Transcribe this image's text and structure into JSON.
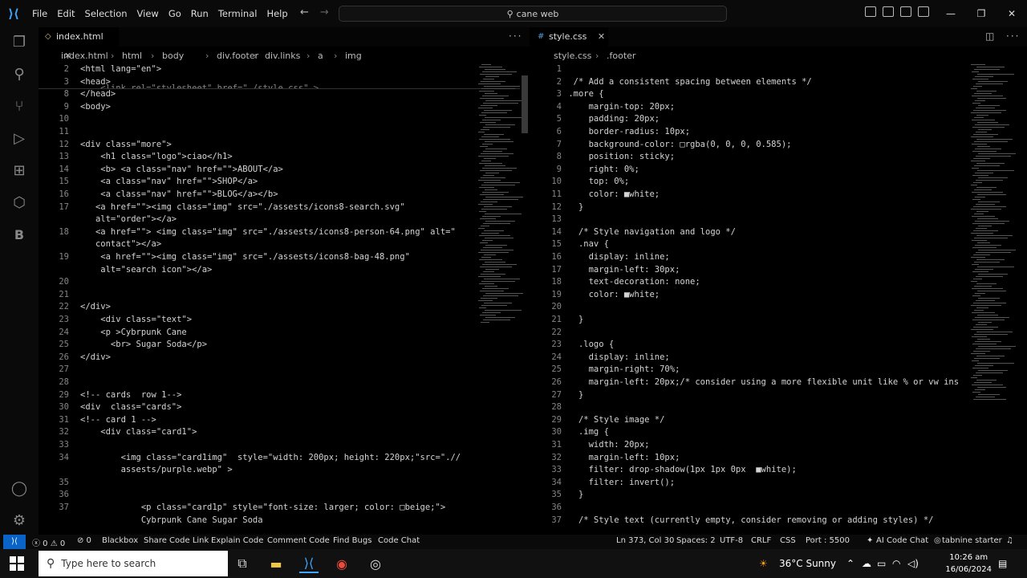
{
  "window": {
    "search_text": "cane web",
    "menu": [
      "File",
      "Edit",
      "Selection",
      "View",
      "Go",
      "Run",
      "Terminal",
      "Help"
    ]
  },
  "left_editor": {
    "tab": "index.html",
    "breadcrumb": [
      "index.html",
      "html",
      "body",
      "div.footer",
      "div.links",
      "a",
      "img"
    ],
    "lines": [
      {
        "n": "2",
        "text": "<html lang=\"en\">"
      },
      {
        "n": "3",
        "text": "<head>"
      },
      {
        "n": "8",
        "text": "</head>"
      },
      {
        "n": "9",
        "text": "<body>"
      },
      {
        "n": "10",
        "text": ""
      },
      {
        "n": "11",
        "text": ""
      },
      {
        "n": "12",
        "text": "<div class=\"more\">"
      },
      {
        "n": "13",
        "text": "    <h1 class=\"logo\">ciao</h1>"
      },
      {
        "n": "14",
        "text": "    <b> <a class=\"nav\" href=\"\">ABOUT</a>"
      },
      {
        "n": "15",
        "text": "    <a class=\"nav\" href=\"\">SHOP</a>"
      },
      {
        "n": "16",
        "text": "    <a class=\"nav\" href=\"\">BLOG</a></b>"
      },
      {
        "n": "17",
        "text": "   <a href=\"\"><img class=\"img\" src=\"./assests/icons8-search.svg\""
      },
      {
        "n": "",
        "text": "   alt=\"order\"></a>"
      },
      {
        "n": "18",
        "text": "   <a href=\"\"> <img class=\"img\" src=\"./assests/icons8-person-64.png\" alt=\""
      },
      {
        "n": "",
        "text": "   contact\"></a>"
      },
      {
        "n": "19",
        "text": "    <a href=\"\"><img class=\"img\" src=\"./assests/icons8-bag-48.png\""
      },
      {
        "n": "",
        "text": "    alt=\"search icon\"></a>"
      },
      {
        "n": "20",
        "text": ""
      },
      {
        "n": "21",
        "text": ""
      },
      {
        "n": "22",
        "text": "</div>"
      },
      {
        "n": "23",
        "text": "    <div class=\"text\">"
      },
      {
        "n": "24",
        "text": "    <p >Cybrpunk Cane"
      },
      {
        "n": "25",
        "text": "      <br> Sugar Soda</p>"
      },
      {
        "n": "26",
        "text": "</div>"
      },
      {
        "n": "27",
        "text": ""
      },
      {
        "n": "28",
        "text": ""
      },
      {
        "n": "29",
        "text": "<!-- cards  row 1-->"
      },
      {
        "n": "30",
        "text": "<div  class=\"cards\">"
      },
      {
        "n": "31",
        "text": "<!-- card 1 -->"
      },
      {
        "n": "32",
        "text": "    <div class=\"card1\">"
      },
      {
        "n": "33",
        "text": ""
      },
      {
        "n": "34",
        "text": "        <img class=\"card1img\"  style=\"width: 200px; height: 220px;\"src=\".//"
      },
      {
        "n": "",
        "text": "        assests/purple.webp\" >"
      },
      {
        "n": "35",
        "text": ""
      },
      {
        "n": "36",
        "text": ""
      },
      {
        "n": "37",
        "text": "            <p class=\"card1p\" style=\"font-size: larger; color: □beige;\">"
      },
      {
        "n": "",
        "text": "            Cybrpunk Cane Sugar Soda"
      }
    ],
    "sticky_partial": "    <link rel=\"stylesheet\" href=\"./style.css\" >"
  },
  "right_editor": {
    "tab": "style.css",
    "breadcrumb": [
      "style.css",
      ".footer"
    ],
    "lines": [
      {
        "n": "1",
        "text": ""
      },
      {
        "n": "2",
        "text": "  /* Add a consistent spacing between elements */"
      },
      {
        "n": "3",
        "text": " .more {"
      },
      {
        "n": "4",
        "text": "     margin-top: 20px;"
      },
      {
        "n": "5",
        "text": "     padding: 20px;"
      },
      {
        "n": "6",
        "text": "     border-radius: 10px;"
      },
      {
        "n": "7",
        "text": "     background-color: □rgba(0, 0, 0, 0.585);"
      },
      {
        "n": "8",
        "text": "     position: sticky;"
      },
      {
        "n": "9",
        "text": "     right: 0%;"
      },
      {
        "n": "10",
        "text": "     top: 0%;"
      },
      {
        "n": "11",
        "text": "     color: ■white;"
      },
      {
        "n": "12",
        "text": "   }"
      },
      {
        "n": "13",
        "text": ""
      },
      {
        "n": "14",
        "text": "   /* Style navigation and logo */"
      },
      {
        "n": "15",
        "text": "   .nav {"
      },
      {
        "n": "16",
        "text": "     display: inline;"
      },
      {
        "n": "17",
        "text": "     margin-left: 30px;"
      },
      {
        "n": "18",
        "text": "     text-decoration: none;"
      },
      {
        "n": "19",
        "text": "     color: ■white;"
      },
      {
        "n": "20",
        "text": ""
      },
      {
        "n": "21",
        "text": "   }"
      },
      {
        "n": "22",
        "text": ""
      },
      {
        "n": "23",
        "text": "   .logo {"
      },
      {
        "n": "24",
        "text": "     display: inline;"
      },
      {
        "n": "25",
        "text": "     margin-right: 70%;"
      },
      {
        "n": "26",
        "text": "     margin-left: 20px;/* consider using a more flexible unit like % or vw ins"
      },
      {
        "n": "27",
        "text": "   }"
      },
      {
        "n": "28",
        "text": ""
      },
      {
        "n": "29",
        "text": "   /* Style image */"
      },
      {
        "n": "30",
        "text": "   .img {"
      },
      {
        "n": "31",
        "text": "     width: 20px;"
      },
      {
        "n": "32",
        "text": "     margin-left: 10px;"
      },
      {
        "n": "33",
        "text": "     filter: drop-shadow(1px 1px 0px  ■white);"
      },
      {
        "n": "34",
        "text": "     filter: invert();"
      },
      {
        "n": "35",
        "text": "   }"
      },
      {
        "n": "36",
        "text": ""
      },
      {
        "n": "37",
        "text": "   /* Style text (currently empty, consider removing or adding styles) */"
      }
    ]
  },
  "statusbar": {
    "errors": "ⓧ 0 ⚠ 0",
    "info": "⊘ 0",
    "items_left": [
      "Blackbox",
      "Share Code Link",
      "Explain Code",
      "Comment Code",
      "Find Bugs",
      "Code Chat"
    ],
    "position": "Ln 373, Col 30",
    "spaces": "Spaces: 2",
    "encoding": "UTF-8",
    "eol": "CRLF",
    "language": "CSS",
    "port": "Port : 5500",
    "ai_chat": "AI Code Chat",
    "tabnine": "tabnine starter"
  },
  "taskbar": {
    "search_placeholder": "Type here to search",
    "weather": "36°C  Sunny",
    "time": "10:26 am",
    "date": "16/06/2024"
  }
}
